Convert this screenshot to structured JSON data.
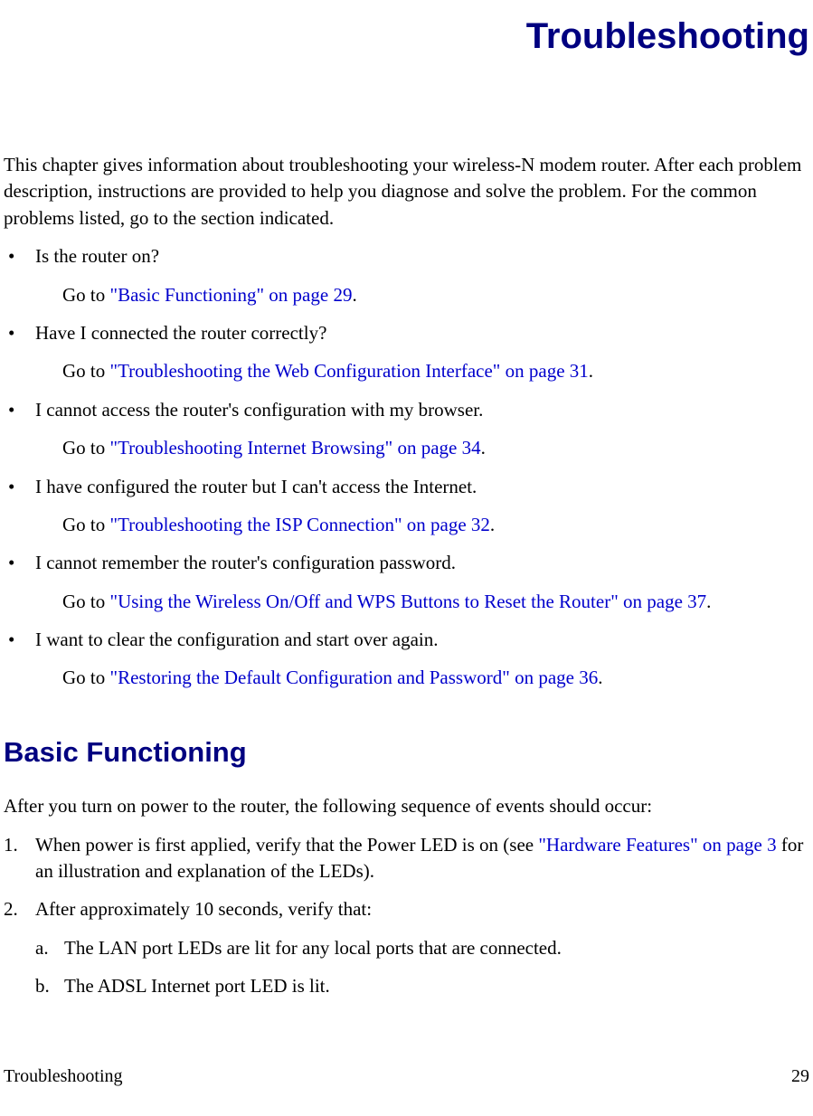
{
  "chapterTitle": "Troubleshooting",
  "intro": "This chapter gives information about troubleshooting your wireless-N modem router. After each problem description, instructions are provided to help you diagnose and solve the problem. For the common problems listed, go to the section indicated.",
  "goto": "Go to ",
  "period": ".",
  "bullets": [
    {
      "q": "Is the router on?",
      "link": "\"Basic Functioning\" on page 29"
    },
    {
      "q": "Have I connected the router correctly?",
      "link": "\"Troubleshooting the Web Configuration Interface\" on page 31"
    },
    {
      "q": "I cannot access the router's configuration with my browser.",
      "link": "\"Troubleshooting Internet Browsing\" on page 34"
    },
    {
      "q": "I have configured the router but I can't access the Internet.",
      "link": "\"Troubleshooting the ISP Connection\" on page 32"
    },
    {
      "q": "I cannot remember the router's configuration password.",
      "link": "\"Using the Wireless On/Off and WPS Buttons to Reset the Router\" on page 37"
    },
    {
      "q": "I want to clear the configuration and start over again.",
      "link": "\"Restoring the Default Configuration and Password\" on page 36"
    }
  ],
  "section1": {
    "title": "Basic Functioning",
    "intro": "After you turn on power to the router, the following sequence of events should occur:",
    "step1_a": "When power is first applied, verify that the Power LED is on (see ",
    "step1_link": "\"Hardware Features\" on page 3",
    "step1_b": " for an illustration and explanation of the LEDs).",
    "step2": "After approximately 10 seconds, verify that:",
    "step2a": "The LAN port LEDs are lit for any local ports that are connected.",
    "step2b": "The ADSL Internet port LED is lit."
  },
  "footer": {
    "left": "Troubleshooting",
    "right": "29"
  }
}
